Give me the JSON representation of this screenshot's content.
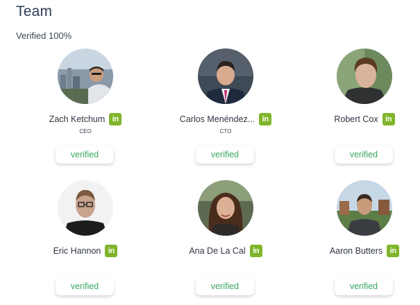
{
  "section": {
    "title": "Team",
    "subtitle": "Verified 100%"
  },
  "colors": {
    "linkedin": "#7fb52b",
    "verified_text": "#3aa863",
    "title": "#2f3c55"
  },
  "members": [
    {
      "name": "Zach Ketchum",
      "role": "CEO",
      "verified_label": "verified",
      "linkedin": "in"
    },
    {
      "name": "Carlos Menéndez...",
      "role": "CTO",
      "verified_label": "verified",
      "linkedin": "in"
    },
    {
      "name": "Robert Cox",
      "role": "",
      "verified_label": "verified",
      "linkedin": "in"
    },
    {
      "name": "Eric Hannon",
      "role": "",
      "verified_label": "verified",
      "linkedin": "in"
    },
    {
      "name": "Ana De La Cal",
      "role": "",
      "verified_label": "verified",
      "linkedin": "in"
    },
    {
      "name": "Aaron Butters",
      "role": "",
      "verified_label": "verified",
      "linkedin": "in"
    }
  ]
}
